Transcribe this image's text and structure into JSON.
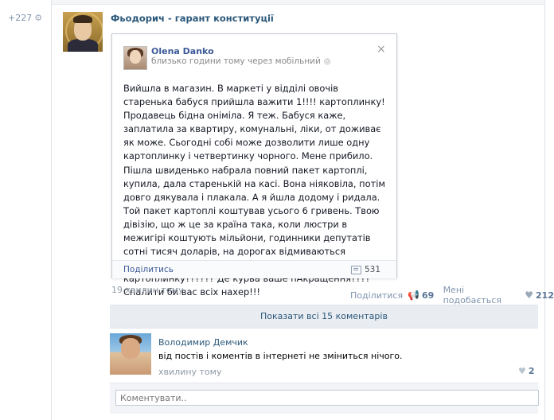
{
  "feed": {
    "post_counter": "+227"
  },
  "post": {
    "author": "Фьодорич - гарант конституції",
    "time": "19 хвилин тому",
    "share_label": "Поділитися",
    "share_count": "69",
    "like_label": "Мені подобається",
    "like_count": "212",
    "show_comments_label": "Показати всі 15 коментарів"
  },
  "embed": {
    "author": "Olena Danko",
    "time": "близько години тому через мобільний",
    "text": "Вийшла в магазин. В маркеті у відділі овочів старенька бабуся прийшла важити 1!!!! картоплинку! Продавець бідна оніміла. Я теж. Бабуся каже, заплатила за квартиру, комунальні, ліки, от доживає як може. Сьогодні собі може дозволити лише одну картоплинку і четвертинку чорного. Мене прибило. Пішла швиденько набрала повний пакет картоплі, купила, дала старенькій на касі. Вона ніяковіла, потім довго дякувала і плакала. А я йшла додому і ридала. Той пакет картоплі коштував усього 6 гривень. Твою дівізію, що ж це за країна така, коли люстри в межигірі коштують мільйони, годинники депутатів сотні тисяч доларів, на дорогах відмиваються мільярди, а бабуся стоїть і важить одну картоплинку?????? Де курва ваше пАкращення???? Спалити би вас всіх нахер!!!",
    "share_label": "Поділитись",
    "comments_count": "531"
  },
  "comment": {
    "author": "Володимир Демчик",
    "text": "від постів і коментів в інтернеті не зміниться нічого.",
    "time": "хвилину тому",
    "likes": "2"
  },
  "reply": {
    "placeholder": "Коментувати.."
  },
  "icons": {
    "settings": "gear-icon",
    "close": "close-icon",
    "globe": "globe-icon",
    "comment": "comment-icon",
    "share": "megaphone-icon",
    "like": "heart-icon"
  },
  "colors": {
    "link": "#2b587a",
    "facebook_link": "#3b5998",
    "muted": "#909aa5",
    "panel": "#e9edf1"
  }
}
